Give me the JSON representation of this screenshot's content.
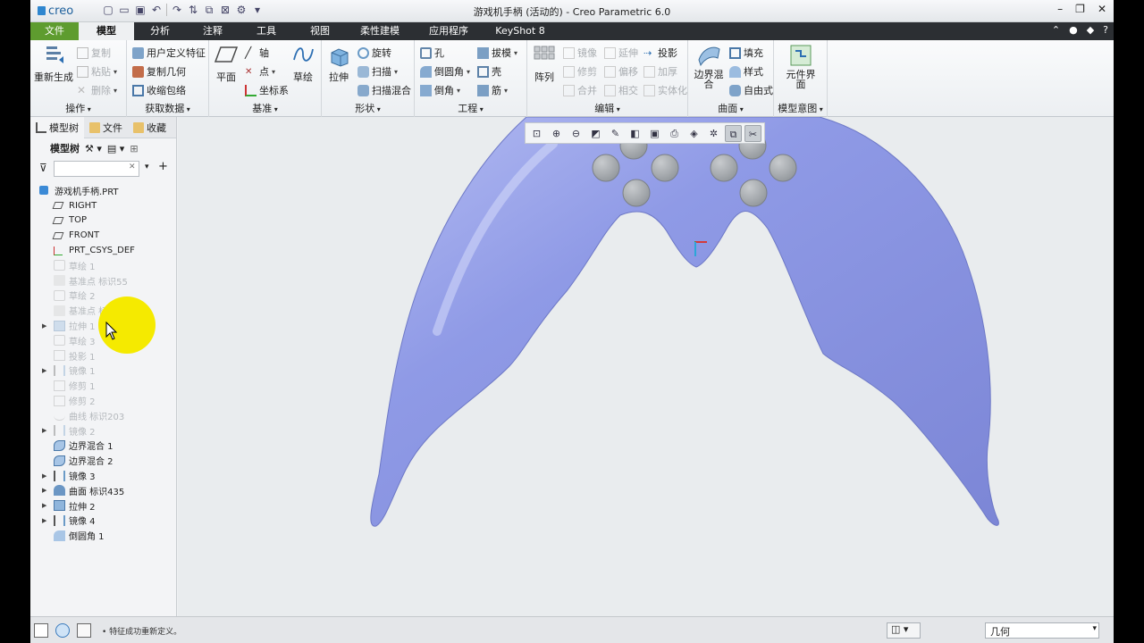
{
  "titlebar": {
    "logo": "creo",
    "title": "游戏机手柄 (活动的) - Creo Parametric 6.0",
    "window_buttons": [
      "–",
      "❐",
      "✕"
    ]
  },
  "menu": {
    "tabs": [
      "文件",
      "模型",
      "分析",
      "注释",
      "工具",
      "视图",
      "柔性建模",
      "应用程序",
      "KeyShot 8"
    ],
    "active": "模型"
  },
  "ribbon": {
    "operations": {
      "label": "操作",
      "regenerate": "重新生成",
      "copy": "复制",
      "paste": "粘贴",
      "delete": "删除"
    },
    "get_data": {
      "label": "获取数据",
      "udf": "用户定义特征",
      "copy_geom": "复制几何",
      "shrinkwrap": "收缩包络"
    },
    "datum": {
      "label": "基准",
      "plane": "平面",
      "axis": "轴",
      "point": "点",
      "csys": "坐标系",
      "sketch": "草绘"
    },
    "shapes": {
      "label": "形状",
      "extrude": "拉伸",
      "revolve": "旋转",
      "sweep": "扫描",
      "swept_blend": "扫描混合"
    },
    "engineering": {
      "label": "工程",
      "hole": "孔",
      "round": "倒圆角",
      "chamfer": "倒角",
      "draft": "拔模",
      "shell": "壳",
      "rib": "筋"
    },
    "editing": {
      "label": "编辑",
      "pattern": "阵列",
      "mirror": "镜像",
      "extend": "延伸",
      "project": "投影",
      "trim": "修剪",
      "offset": "偏移",
      "thicken": "加厚",
      "merge": "合并",
      "intersect": "相交",
      "solidify": "实体化"
    },
    "surfaces": {
      "label": "曲面",
      "boundary_blend": "边界混合",
      "fill": "填充",
      "style": "样式",
      "freestyle": "自由式"
    },
    "model_intent": {
      "label": "模型意图",
      "component_interface": "元件界面"
    }
  },
  "panel": {
    "tabs": [
      "模型树",
      "文件",
      "收藏"
    ],
    "tree_header": "模型树",
    "filter_placeholder": ""
  },
  "tree": [
    {
      "label": "游戏机手柄.PRT",
      "icon": "part-icon",
      "root": true,
      "expandable": false,
      "suppressed": false
    },
    {
      "label": "RIGHT",
      "icon": "datum-plane-icon",
      "expandable": false,
      "suppressed": false
    },
    {
      "label": "TOP",
      "icon": "datum-plane-icon",
      "expandable": false,
      "suppressed": false
    },
    {
      "label": "FRONT",
      "icon": "datum-plane-icon",
      "expandable": false,
      "suppressed": false
    },
    {
      "label": "PRT_CSYS_DEF",
      "icon": "csys-icon",
      "expandable": false,
      "suppressed": false
    },
    {
      "label": "草绘 1",
      "icon": "sketch-icon",
      "expandable": false,
      "suppressed": true
    },
    {
      "label": "基准点 标识55",
      "icon": "datum-point-icon",
      "expandable": false,
      "suppressed": true
    },
    {
      "label": "草绘 2",
      "icon": "sketch-icon",
      "expandable": false,
      "suppressed": true
    },
    {
      "label": "基准点 标识63",
      "icon": "datum-point-icon",
      "expandable": false,
      "suppressed": true
    },
    {
      "label": "拉伸 1",
      "icon": "extrude-icon",
      "expandable": true,
      "suppressed": true
    },
    {
      "label": "草绘 3",
      "icon": "sketch-icon",
      "expandable": false,
      "suppressed": true
    },
    {
      "label": "投影 1",
      "icon": "project-icon",
      "expandable": false,
      "suppressed": true
    },
    {
      "label": "镜像 1",
      "icon": "mirror-icon",
      "expandable": true,
      "suppressed": true
    },
    {
      "label": "修剪 1",
      "icon": "trim-icon",
      "expandable": false,
      "suppressed": true
    },
    {
      "label": "修剪 2",
      "icon": "trim-icon",
      "expandable": false,
      "suppressed": true
    },
    {
      "label": "曲线 标识203",
      "icon": "curve-icon",
      "expandable": false,
      "suppressed": true
    },
    {
      "label": "镜像 2",
      "icon": "mirror-icon",
      "expandable": true,
      "suppressed": true
    },
    {
      "label": "边界混合 1",
      "icon": "boundary-blend-icon",
      "expandable": false,
      "suppressed": false
    },
    {
      "label": "边界混合 2",
      "icon": "boundary-blend-icon",
      "expandable": false,
      "suppressed": false
    },
    {
      "label": "镜像 3",
      "icon": "mirror-icon",
      "expandable": true,
      "suppressed": false
    },
    {
      "label": "曲面 标识435",
      "icon": "surface-icon",
      "expandable": true,
      "suppressed": false
    },
    {
      "label": "拉伸 2",
      "icon": "extrude-icon",
      "expandable": true,
      "suppressed": false
    },
    {
      "label": "镜像 4",
      "icon": "mirror-icon",
      "expandable": true,
      "suppressed": false
    },
    {
      "label": "倒圆角 1",
      "icon": "round-icon",
      "expandable": false,
      "suppressed": false
    }
  ],
  "status": {
    "message": "• 特征成功重新定义。",
    "selection_filter": "几何"
  },
  "colors": {
    "model_body": "#8f9ae6",
    "button_gray": "#9a9ea3",
    "file_tab": "#5e9c2f",
    "cursor_highlight": "#f5ea00"
  }
}
